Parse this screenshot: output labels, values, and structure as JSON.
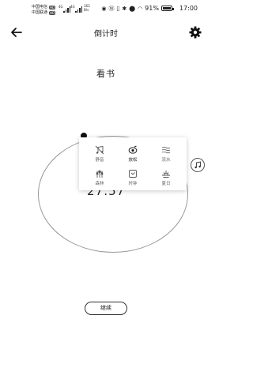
{
  "status_bar": {
    "carrier_1": "中国电信",
    "carrier_1_badge": "HD",
    "carrier_2": "中国联通",
    "carrier_2_badge": "HD",
    "net_type_1": "4G",
    "net_type_2": "4G",
    "data_speed": "163\nB/s",
    "battery_percent": "91%",
    "time": "17:00"
  },
  "header": {
    "title": "倒计时",
    "back_icon": "arrow-left-icon",
    "settings_icon": "gear-icon"
  },
  "task": {
    "name": "看书"
  },
  "timer": {
    "display": "27:57"
  },
  "sound_menu": {
    "options": [
      {
        "label": "静音",
        "icon": "mute-icon",
        "selected": false
      },
      {
        "label": "放松",
        "icon": "relax-icon",
        "selected": true
      },
      {
        "label": "流水",
        "icon": "water-icon",
        "selected": false
      },
      {
        "label": "森林",
        "icon": "forest-icon",
        "selected": false
      },
      {
        "label": "时钟",
        "icon": "clock-icon",
        "selected": false
      },
      {
        "label": "夏日",
        "icon": "summer-icon",
        "selected": false
      }
    ]
  },
  "music_button": {
    "icon": "music-note-icon"
  },
  "actions": {
    "continue_label": "继续"
  }
}
